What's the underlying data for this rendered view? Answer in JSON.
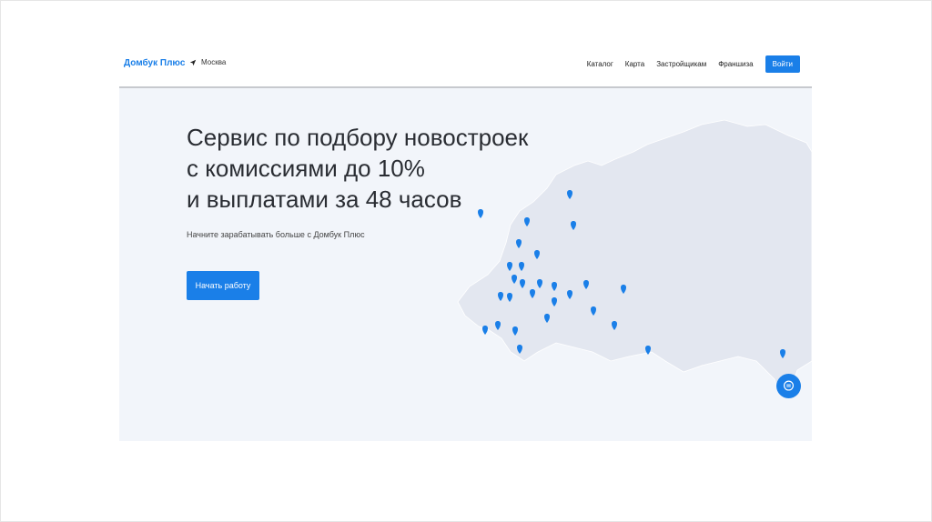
{
  "header": {
    "logo": "Домбук Плюс",
    "city": "Москва",
    "nav": [
      "Каталог",
      "Карта",
      "Застройщикам",
      "Франшиза"
    ],
    "login": "Войти"
  },
  "hero": {
    "title_lines": [
      "Сервис по подбору новостроек",
      "с комиссиями до 10%",
      "и выплатами за 48 часов"
    ],
    "subtitle": "Начните зарабатывать больше с Домбук Плюс",
    "cta": "Начать работу"
  },
  "colors": {
    "accent": "#1a7fe8",
    "hero_bg": "#f2f5fa",
    "map": "#e3e7f0"
  }
}
